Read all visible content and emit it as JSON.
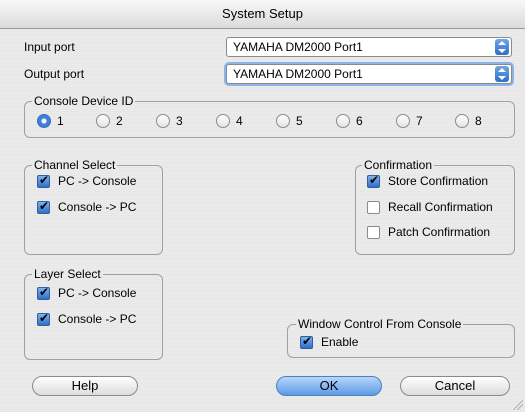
{
  "window": {
    "title": "System Setup"
  },
  "ports": {
    "input_label": "Input port",
    "input_value": "YAMAHA DM2000 Port1",
    "output_label": "Output port",
    "output_value": "YAMAHA DM2000 Port1"
  },
  "console_device_id": {
    "title": "Console Device ID",
    "options": [
      "1",
      "2",
      "3",
      "4",
      "5",
      "6",
      "7",
      "8"
    ],
    "selected": "1"
  },
  "channel_select": {
    "title": "Channel Select",
    "items": [
      {
        "label": "PC -> Console",
        "checked": true
      },
      {
        "label": "Console -> PC",
        "checked": true
      }
    ]
  },
  "confirmation": {
    "title": "Confirmation",
    "items": [
      {
        "label": "Store Confirmation",
        "checked": true
      },
      {
        "label": "Recall Confirmation",
        "checked": false
      },
      {
        "label": "Patch Confirmation",
        "checked": false
      }
    ]
  },
  "layer_select": {
    "title": "Layer Select",
    "items": [
      {
        "label": "PC -> Console",
        "checked": true
      },
      {
        "label": "Console -> PC",
        "checked": true
      }
    ]
  },
  "window_control": {
    "title": "Window  Control From Console",
    "enable_label": "Enable",
    "enable_checked": true
  },
  "buttons": {
    "help": "Help",
    "ok": "OK",
    "cancel": "Cancel"
  }
}
